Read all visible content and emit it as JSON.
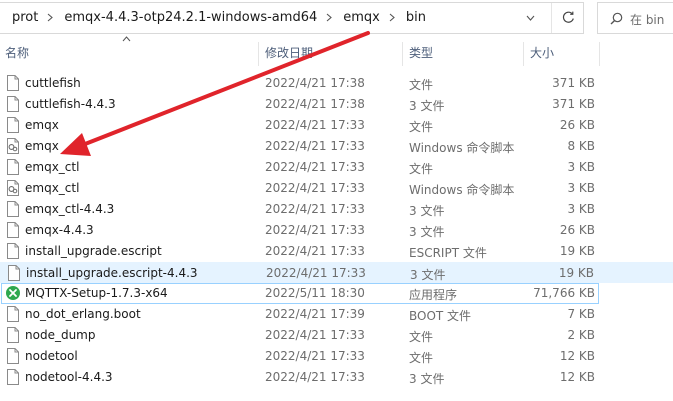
{
  "breadcrumb": [
    "prot",
    "emqx-4.4.3-otp24.2.1-windows-amd64",
    "emqx",
    "bin"
  ],
  "search": {
    "placeholder": "在 bin"
  },
  "columns": {
    "name": "名称",
    "date": "修改日期",
    "type": "类型",
    "size": "大小"
  },
  "files": [
    {
      "name": "cuttlefish",
      "date": "2022/4/21 17:38",
      "type": "文件",
      "size": "371 KB",
      "icon": "file-icon"
    },
    {
      "name": "cuttlefish-4.4.3",
      "date": "2022/4/21 17:38",
      "type": "3 文件",
      "size": "371 KB",
      "icon": "file-icon"
    },
    {
      "name": "emqx",
      "date": "2022/4/21 17:33",
      "type": "文件",
      "size": "26 KB",
      "icon": "file-icon"
    },
    {
      "name": "emqx",
      "date": "2022/4/21 17:33",
      "type": "Windows 命令脚本",
      "size": "8 KB",
      "icon": "batch-script-icon"
    },
    {
      "name": "emqx_ctl",
      "date": "2022/4/21 17:33",
      "type": "文件",
      "size": "3 KB",
      "icon": "file-icon"
    },
    {
      "name": "emqx_ctl",
      "date": "2022/4/21 17:33",
      "type": "Windows 命令脚本",
      "size": "3 KB",
      "icon": "batch-script-icon"
    },
    {
      "name": "emqx_ctl-4.4.3",
      "date": "2022/4/21 17:33",
      "type": "3 文件",
      "size": "3 KB",
      "icon": "file-icon"
    },
    {
      "name": "emqx-4.4.3",
      "date": "2022/4/21 17:33",
      "type": "3 文件",
      "size": "26 KB",
      "icon": "file-icon"
    },
    {
      "name": "install_upgrade.escript",
      "date": "2022/4/21 17:33",
      "type": "ESCRIPT 文件",
      "size": "19 KB",
      "icon": "file-icon"
    },
    {
      "name": "install_upgrade.escript-4.4.3",
      "date": "2022/4/21 17:33",
      "type": "3 文件",
      "size": "19 KB",
      "icon": "file-icon"
    },
    {
      "name": "MQTTX-Setup-1.7.3-x64",
      "date": "2022/5/11 18:30",
      "type": "应用程序",
      "size": "71,766 KB",
      "icon": "mqttx-app-icon"
    },
    {
      "name": "no_dot_erlang.boot",
      "date": "2022/4/21 17:39",
      "type": "BOOT 文件",
      "size": "7 KB",
      "icon": "file-icon"
    },
    {
      "name": "node_dump",
      "date": "2022/4/21 17:33",
      "type": "文件",
      "size": "2 KB",
      "icon": "file-icon"
    },
    {
      "name": "nodetool",
      "date": "2022/4/21 17:33",
      "type": "文件",
      "size": "12 KB",
      "icon": "file-icon"
    },
    {
      "name": "nodetool-4.4.3",
      "date": "2022/4/21 17:33",
      "type": "3 文件",
      "size": "12 KB",
      "icon": "file-icon"
    }
  ],
  "colors": {
    "accent": "#cce8ff",
    "annotation_arrow": "#e0242b",
    "header_text": "#4d5e7a"
  }
}
